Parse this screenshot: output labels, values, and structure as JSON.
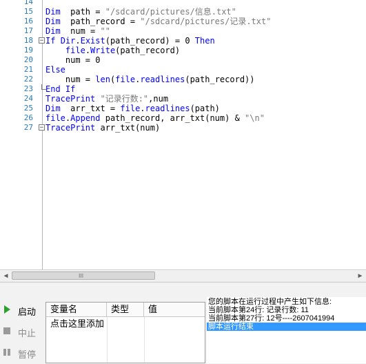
{
  "editor": {
    "lines": [
      {
        "num": "14",
        "fold": "",
        "parts": []
      },
      {
        "num": "15",
        "fold": "",
        "parts": [
          [
            "kw",
            "Dim"
          ],
          [
            "",
            "  path = "
          ],
          [
            "str",
            "\"/sdcard/pictures/信息.txt\""
          ]
        ]
      },
      {
        "num": "16",
        "fold": "",
        "parts": [
          [
            "kw",
            "Dim"
          ],
          [
            "",
            "  path_record = "
          ],
          [
            "str",
            "\"/sdcard/pictures/记录.txt\""
          ]
        ]
      },
      {
        "num": "17",
        "fold": "",
        "parts": [
          [
            "kw",
            "Dim"
          ],
          [
            "",
            "  num = "
          ],
          [
            "str",
            "\"\""
          ]
        ]
      },
      {
        "num": "18",
        "fold": "minus",
        "parts": [
          [
            "kw",
            "If"
          ],
          [
            "",
            " "
          ],
          [
            "fn",
            "Dir"
          ],
          [
            "",
            "."
          ],
          [
            "fn",
            "Exist"
          ],
          [
            "",
            "(path_record) = 0 "
          ],
          [
            "kw",
            "Then"
          ]
        ]
      },
      {
        "num": "19",
        "fold": "",
        "parts": [
          [
            "",
            "    "
          ],
          [
            "fn",
            "file"
          ],
          [
            "",
            "."
          ],
          [
            "fn",
            "Write"
          ],
          [
            "",
            "(path_record)"
          ]
        ]
      },
      {
        "num": "20",
        "fold": "",
        "parts": [
          [
            "",
            "    num = 0"
          ]
        ]
      },
      {
        "num": "21",
        "fold": "",
        "parts": [
          [
            "kw",
            "Else"
          ]
        ]
      },
      {
        "num": "22",
        "fold": "",
        "parts": [
          [
            "",
            "    num = "
          ],
          [
            "fn",
            "len"
          ],
          [
            "",
            "("
          ],
          [
            "fn",
            "file"
          ],
          [
            "",
            "."
          ],
          [
            "fn",
            "readlines"
          ],
          [
            "",
            "(path_record))"
          ]
        ]
      },
      {
        "num": "23",
        "fold": "end",
        "parts": [
          [
            "kw",
            "End If"
          ]
        ]
      },
      {
        "num": "24",
        "fold": "",
        "parts": [
          [
            "fn",
            "TracePrint"
          ],
          [
            "",
            " "
          ],
          [
            "str",
            "\"记录行数:\""
          ],
          [
            "",
            ",num"
          ]
        ]
      },
      {
        "num": "25",
        "fold": "",
        "parts": [
          [
            "kw",
            "Dim"
          ],
          [
            "",
            "  arr_txt = "
          ],
          [
            "fn",
            "file"
          ],
          [
            "",
            "."
          ],
          [
            "fn",
            "readlines"
          ],
          [
            "",
            "(path)"
          ]
        ]
      },
      {
        "num": "26",
        "fold": "",
        "parts": [
          [
            "fn",
            "file"
          ],
          [
            "",
            "."
          ],
          [
            "fn",
            "Append"
          ],
          [
            "",
            " path_record, arr_txt(num) & "
          ],
          [
            "str",
            "\"\\n\""
          ]
        ]
      },
      {
        "num": "27",
        "fold": "minus",
        "parts": [
          [
            "fn",
            "TracePrint"
          ],
          [
            "",
            " arr_txt(num)"
          ]
        ]
      }
    ]
  },
  "scrollbar": {
    "left_arrow": "◀",
    "right_arrow": "▶",
    "grip": "III"
  },
  "controls": {
    "start_label": "启动",
    "stop_label": "中止",
    "pause_label": "暂停"
  },
  "variables": {
    "headers": [
      "变量名",
      "类型",
      "值"
    ],
    "add_hint": "点击这里添加"
  },
  "log": {
    "lines": [
      "您的脚本在运行过程中产生如下信息:",
      "当前脚本第24行: 记录行数:  11",
      "当前脚本第27行: 12号----2607041994",
      "脚本运行结束"
    ]
  },
  "colors": {
    "keyword": "#0000ff",
    "string": "#7a7a7a",
    "line_number": "#2b7ab8",
    "selection": "#3399ff",
    "start_icon": "#2e9e2e"
  }
}
